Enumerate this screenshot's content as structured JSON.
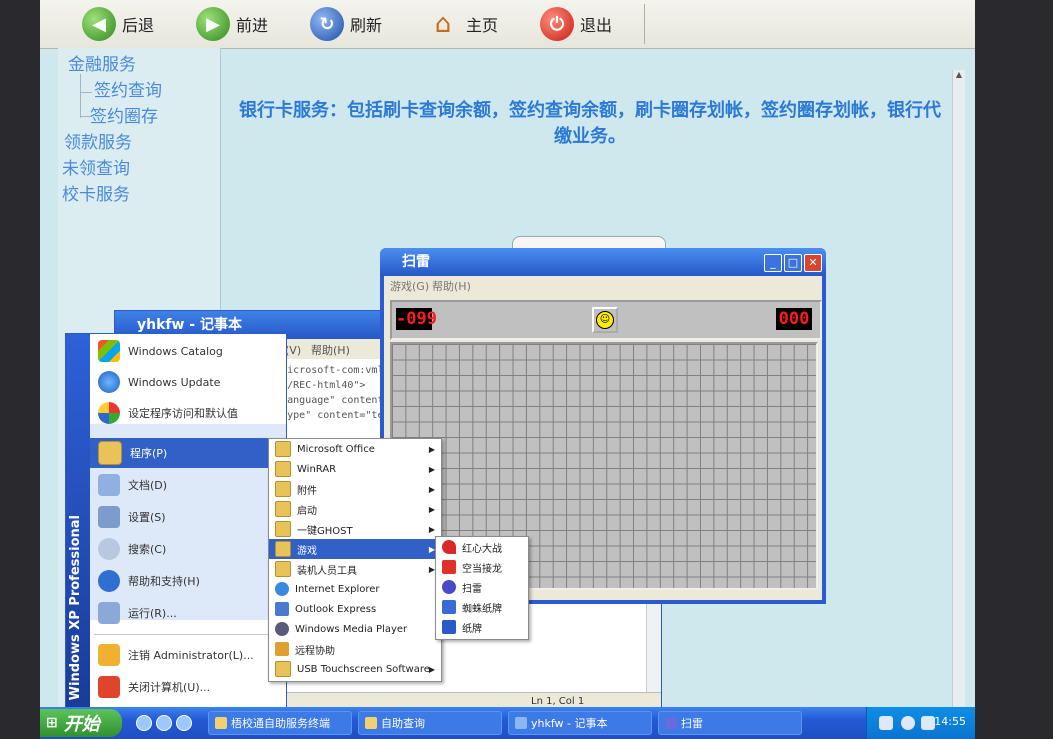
{
  "toolbar": {
    "back": "后退",
    "forward": "前进",
    "refresh": "刷新",
    "home": "主页",
    "exit": "退出"
  },
  "leftnav": {
    "items": [
      "金融服务",
      "签约查询",
      "签约圈存",
      "领款服务",
      "未领查询",
      "校卡服务"
    ]
  },
  "main": {
    "description": "银行卡服务：包括刷卡查询余额，签约查询余额，刷卡圈存划帐，签约圈存划帐，银行代缴业务。"
  },
  "notepad": {
    "title": "yhkfw - 记事本",
    "menu": [
      "查看(V)",
      "帮助(H)"
    ],
    "lines": [
      "hemas-microsoft-com:vml\" x",
      ".org/TR/REC-html40\">",
      "",
      "",
      "ntent-Language\" content=",
      "ntent-Type\" content=\"te"
    ],
    "status": "Ln 1, Col 1"
  },
  "minesweeper": {
    "title": "扫雷",
    "menu": [
      "游戏(G)",
      "帮助(H)"
    ],
    "mines_left": "-099",
    "timer": "000"
  },
  "startmenu": {
    "side_label": "Windows XP Professional",
    "top_items": [
      "Windows Catalog",
      "Windows Update",
      "设定程序访问和默认值"
    ],
    "items": [
      "程序(P)",
      "文档(D)",
      "设置(S)",
      "搜索(C)",
      "帮助和支持(H)",
      "运行(R)..."
    ],
    "bottom_items": [
      "注销 Administrator(L)...",
      "关闭计算机(U)..."
    ]
  },
  "programs": {
    "items": [
      "Microsoft Office",
      "WinRAR",
      "附件",
      "启动",
      "一键GHOST",
      "游戏",
      "装机人员工具",
      "Internet Explorer",
      "Outlook Express",
      "Windows Media Player",
      "远程协助",
      "USB Touchscreen Software"
    ]
  },
  "games": {
    "items": [
      "红心大战",
      "空当接龙",
      "扫雷",
      "蜘蛛纸牌",
      "纸牌"
    ]
  },
  "taskbar": {
    "start": "开始",
    "tasks": [
      "梧校通自助服务终端",
      "自助查询",
      "yhkfw - 记事本",
      "扫雷"
    ],
    "clock": "14:55"
  }
}
